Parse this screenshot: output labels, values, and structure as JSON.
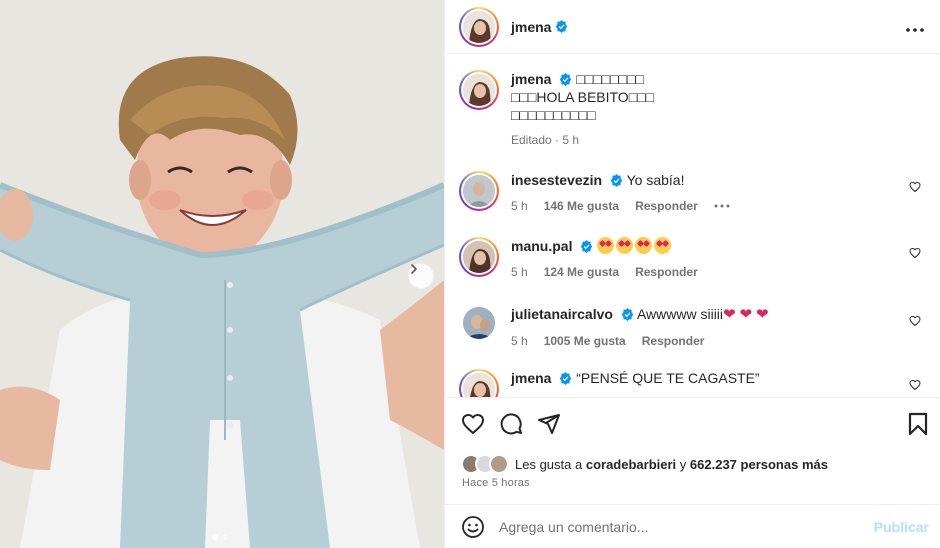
{
  "post": {
    "author": "jmena",
    "verified": true,
    "photo_alt_icon": "kid-photo",
    "carousel": {
      "total_dots": 2,
      "active_index": 0
    }
  },
  "caption": {
    "username": "jmena",
    "lines": [
      "□□□□□□□□",
      "□□□HOLA BEBITO□□□",
      "□□□□□□□□□□"
    ],
    "meta": "Editado · 5 h"
  },
  "comments": [
    {
      "username": "inesestevezin",
      "text": "Yo sabía!",
      "time": "5 h",
      "likes": "146 Me gusta",
      "reply": "Responder",
      "more": true
    },
    {
      "username": "manu.pal",
      "text": "",
      "emoji_count": 4,
      "time": "5 h",
      "likes": "124 Me gusta",
      "reply": "Responder"
    },
    {
      "username": "julietanaircalvo",
      "text": "Awwwww siiiii",
      "hearts": 3,
      "time": "5 h",
      "likes": "1005 Me gusta",
      "reply": "Responder"
    },
    {
      "username": "jmena",
      "text": "“PENSÉ QUE TE CAGASTE”"
    }
  ],
  "likes_row": {
    "prefix": "Les gusta a",
    "user": "coradebarbieri",
    "middle": "y",
    "count": "662.237 personas más"
  },
  "time_ago": "Hace 5 horas",
  "composer": {
    "placeholder": "Agrega un comentario...",
    "publish_label": "Publicar"
  },
  "colors": {
    "verified_blue": "#0095f6",
    "publish_disabled": "#b2dffc",
    "heart_red": "#e0245e"
  }
}
